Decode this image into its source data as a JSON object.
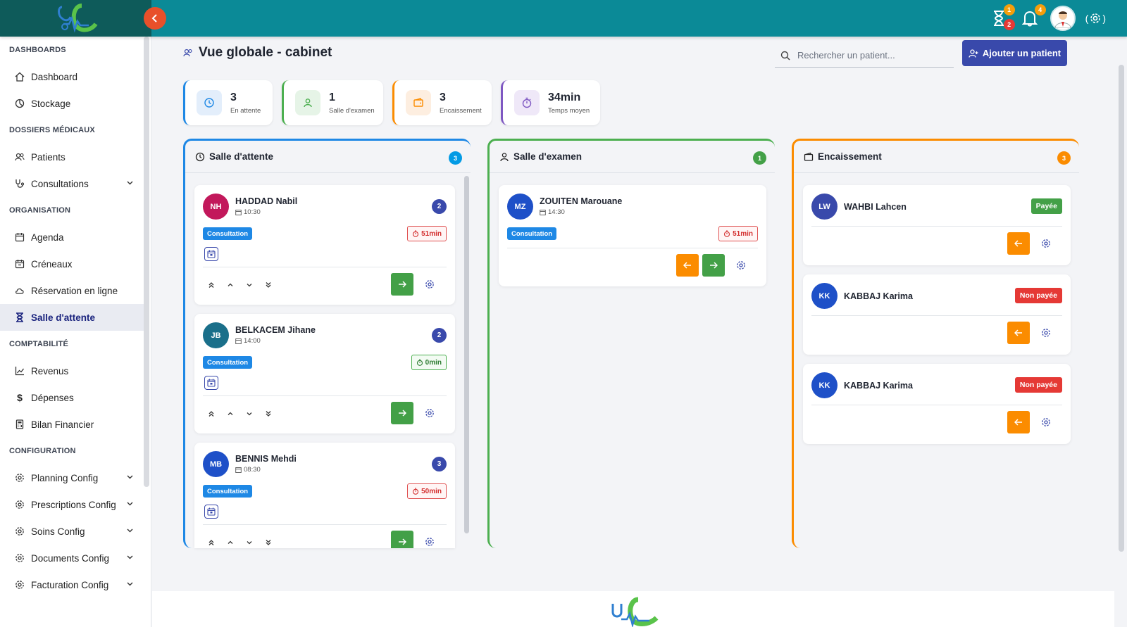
{
  "colors": {
    "topbar": "#0b8a97",
    "primary": "#3949ab",
    "attente": "#1e88e5",
    "examen": "#4caf50",
    "encaissement": "#fb8c00",
    "purple": "#7e57c2"
  },
  "topbar": {
    "hourglass_badge_1": "1",
    "hourglass_badge_2": "2",
    "bell_badge": "4"
  },
  "sidebar": {
    "sections": [
      {
        "title": "DASHBOARDS",
        "items": [
          {
            "label": "Dashboard",
            "icon": "home-icon"
          },
          {
            "label": "Stockage",
            "icon": "pie-icon"
          }
        ]
      },
      {
        "title": "DOSSIERS MÉDICAUX",
        "items": [
          {
            "label": "Patients",
            "icon": "users-icon"
          },
          {
            "label": "Consultations",
            "icon": "stethoscope-icon"
          }
        ]
      },
      {
        "title": "ORGANISATION",
        "items": [
          {
            "label": "Agenda",
            "icon": "calendar-icon"
          },
          {
            "label": "Créneaux",
            "icon": "calendar-icon"
          },
          {
            "label": "Réservation en ligne",
            "icon": "cloud-icon"
          },
          {
            "label": "Salle d'attente",
            "icon": "hourglass-icon"
          }
        ]
      },
      {
        "title": "COMPTABILITÉ",
        "items": [
          {
            "label": "Revenus",
            "icon": "chart-icon"
          },
          {
            "label": "Dépenses",
            "icon": "dollar-icon"
          },
          {
            "label": "Bilan Financier",
            "icon": "calculator-icon"
          }
        ]
      },
      {
        "title": "CONFIGURATION",
        "items": [
          {
            "label": "Planning Config",
            "icon": "gear-icon"
          },
          {
            "label": "Prescriptions Config",
            "icon": "gear-icon"
          },
          {
            "label": "Soins Config",
            "icon": "gear-icon"
          },
          {
            "label": "Documents Config",
            "icon": "gear-icon"
          },
          {
            "label": "Facturation Config",
            "icon": "gear-icon"
          }
        ]
      }
    ]
  },
  "header": {
    "title": "Vue globale - cabinet",
    "search_placeholder": "Rechercher un patient...",
    "add_button": "Ajouter un patient"
  },
  "stats": [
    {
      "value": "3",
      "label": "En attente"
    },
    {
      "value": "1",
      "label": "Salle d'examen"
    },
    {
      "value": "3",
      "label": "Encaissement"
    },
    {
      "value": "34min",
      "label": "Temps moyen"
    }
  ],
  "columns": {
    "attente": {
      "title": "Salle d'attente",
      "count": "3",
      "patients": [
        {
          "initials": "NH",
          "name": "HADDAD Nabil",
          "time": "10:30",
          "count": "2",
          "type": "Consultation",
          "timer": "51min",
          "avatar_color": "#c2185b"
        },
        {
          "initials": "JB",
          "name": "BELKACEM Jihane",
          "time": "14:00",
          "count": "2",
          "type": "Consultation",
          "timer": "0min",
          "avatar_color": "#1a6f8a"
        },
        {
          "initials": "MB",
          "name": "BENNIS Mehdi",
          "time": "08:30",
          "count": "3",
          "type": "Consultation",
          "timer": "50min",
          "avatar_color": "#1e50c8"
        }
      ]
    },
    "examen": {
      "title": "Salle d'examen",
      "count": "1",
      "patients": [
        {
          "initials": "MZ",
          "name": "ZOUITEN Marouane",
          "time": "14:30",
          "type": "Consultation",
          "timer": "51min",
          "avatar_color": "#1e50c8"
        }
      ]
    },
    "encaissement": {
      "title": "Encaissement",
      "count": "3",
      "patients": [
        {
          "initials": "LW",
          "name": "WAHBI Lahcen",
          "status": "Payée",
          "status_color": "#43a047",
          "avatar_color": "#3949ab"
        },
        {
          "initials": "KK",
          "name": "KABBAJ Karima",
          "status": "Non payée",
          "status_color": "#e53935",
          "avatar_color": "#1e50c8"
        },
        {
          "initials": "KK",
          "name": "KABBAJ Karima",
          "status": "Non payée",
          "status_color": "#e53935",
          "avatar_color": "#1e50c8"
        }
      ]
    }
  }
}
